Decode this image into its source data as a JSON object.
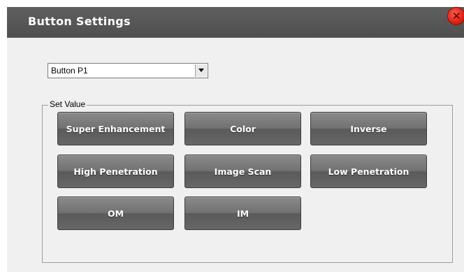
{
  "dialog": {
    "title": "Button Settings",
    "close_icon": "close-icon"
  },
  "button_select": {
    "selected": "Button P1"
  },
  "set_value": {
    "legend": "Set Value",
    "buttons": [
      {
        "label": "Super Enhancement"
      },
      {
        "label": "Color"
      },
      {
        "label": "Inverse"
      },
      {
        "label": "High Penetration"
      },
      {
        "label": "Image Scan"
      },
      {
        "label": "Low Penetration"
      },
      {
        "label": "OM"
      },
      {
        "label": "IM"
      }
    ]
  },
  "colors": {
    "titlebar": "#555555",
    "close": "#e01f10",
    "button": "#707070"
  }
}
